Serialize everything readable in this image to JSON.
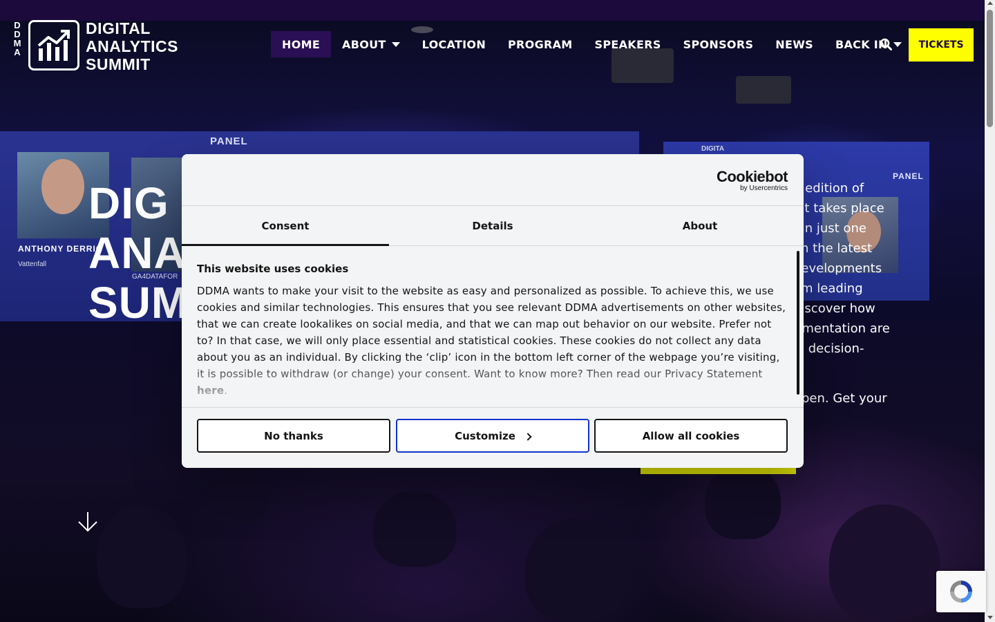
{
  "header": {
    "brand_vertical": [
      "D",
      "D",
      "M",
      "A"
    ],
    "brand_title_lines": [
      "DIGITAL",
      "ANALYTICS",
      "SUMMIT"
    ],
    "nav": [
      {
        "label": "HOME",
        "active": true,
        "dropdown": false
      },
      {
        "label": "ABOUT",
        "active": false,
        "dropdown": true
      },
      {
        "label": "LOCATION",
        "active": false,
        "dropdown": false
      },
      {
        "label": "PROGRAM",
        "active": false,
        "dropdown": false
      },
      {
        "label": "SPEAKERS",
        "active": false,
        "dropdown": false
      },
      {
        "label": "SPONSORS",
        "active": false,
        "dropdown": false
      },
      {
        "label": "NEWS",
        "active": false,
        "dropdown": false
      },
      {
        "label": "BACK IN",
        "active": false,
        "dropdown": true
      }
    ],
    "search_icon": "search-icon",
    "tickets_label": "TICKETS",
    "colors": {
      "top_strip": "#1c0a3c",
      "active_nav": "#2a0f55",
      "tickets_bg": "#ffff00"
    }
  },
  "hero": {
    "title_lines": [
      "DIG",
      "ANA",
      "SUM"
    ],
    "backdrop": {
      "panel_label": "PANEL",
      "speaker_name": "ANTHONY DERRIC",
      "speaker_org": "Vattenfall",
      "speaker_org_2": "GA4DATAFOR",
      "right_panel_label": "PANEL",
      "right_screen_label": "DIGITA"
    },
    "text_lines": "h edition of\nnit takes place\n. In just one\n on the latest\ndevelopments\nom leading\n discover how\nrimentation are\nal decision-",
    "text_tail": "pen. Get your",
    "scroll_icon": "arrow-down-icon"
  },
  "cookie_dialog": {
    "brand": "Cookiebot",
    "brand_sub": "by Usercentrics",
    "tabs": [
      {
        "label": "Consent",
        "active": true
      },
      {
        "label": "Details",
        "active": false
      },
      {
        "label": "About",
        "active": false
      }
    ],
    "heading": "This website uses cookies",
    "body": "DDMA wants to make your visit to the website as easy and personalized as possible. To achieve this, we use cookies and similar technologies. This ensures that you see relevant DDMA advertisements on other websites, that we can create lookalikes on social media, and that we can map out behavior on our website. Prefer not to? In that case, we will only place essential and statistical cookies. These cookies do not collect any data about you as an individual. By clicking the ‘clip’ icon in the bottom left corner of the webpage you’re visiting, it is possible to withdraw (or change) your consent. Want to know more? Then read our Privacy Statement ",
    "link_text": "here",
    "body_end": ".",
    "buttons": {
      "no_thanks": "No thanks",
      "customize": "Customize",
      "allow_all": "Allow all cookies"
    }
  }
}
